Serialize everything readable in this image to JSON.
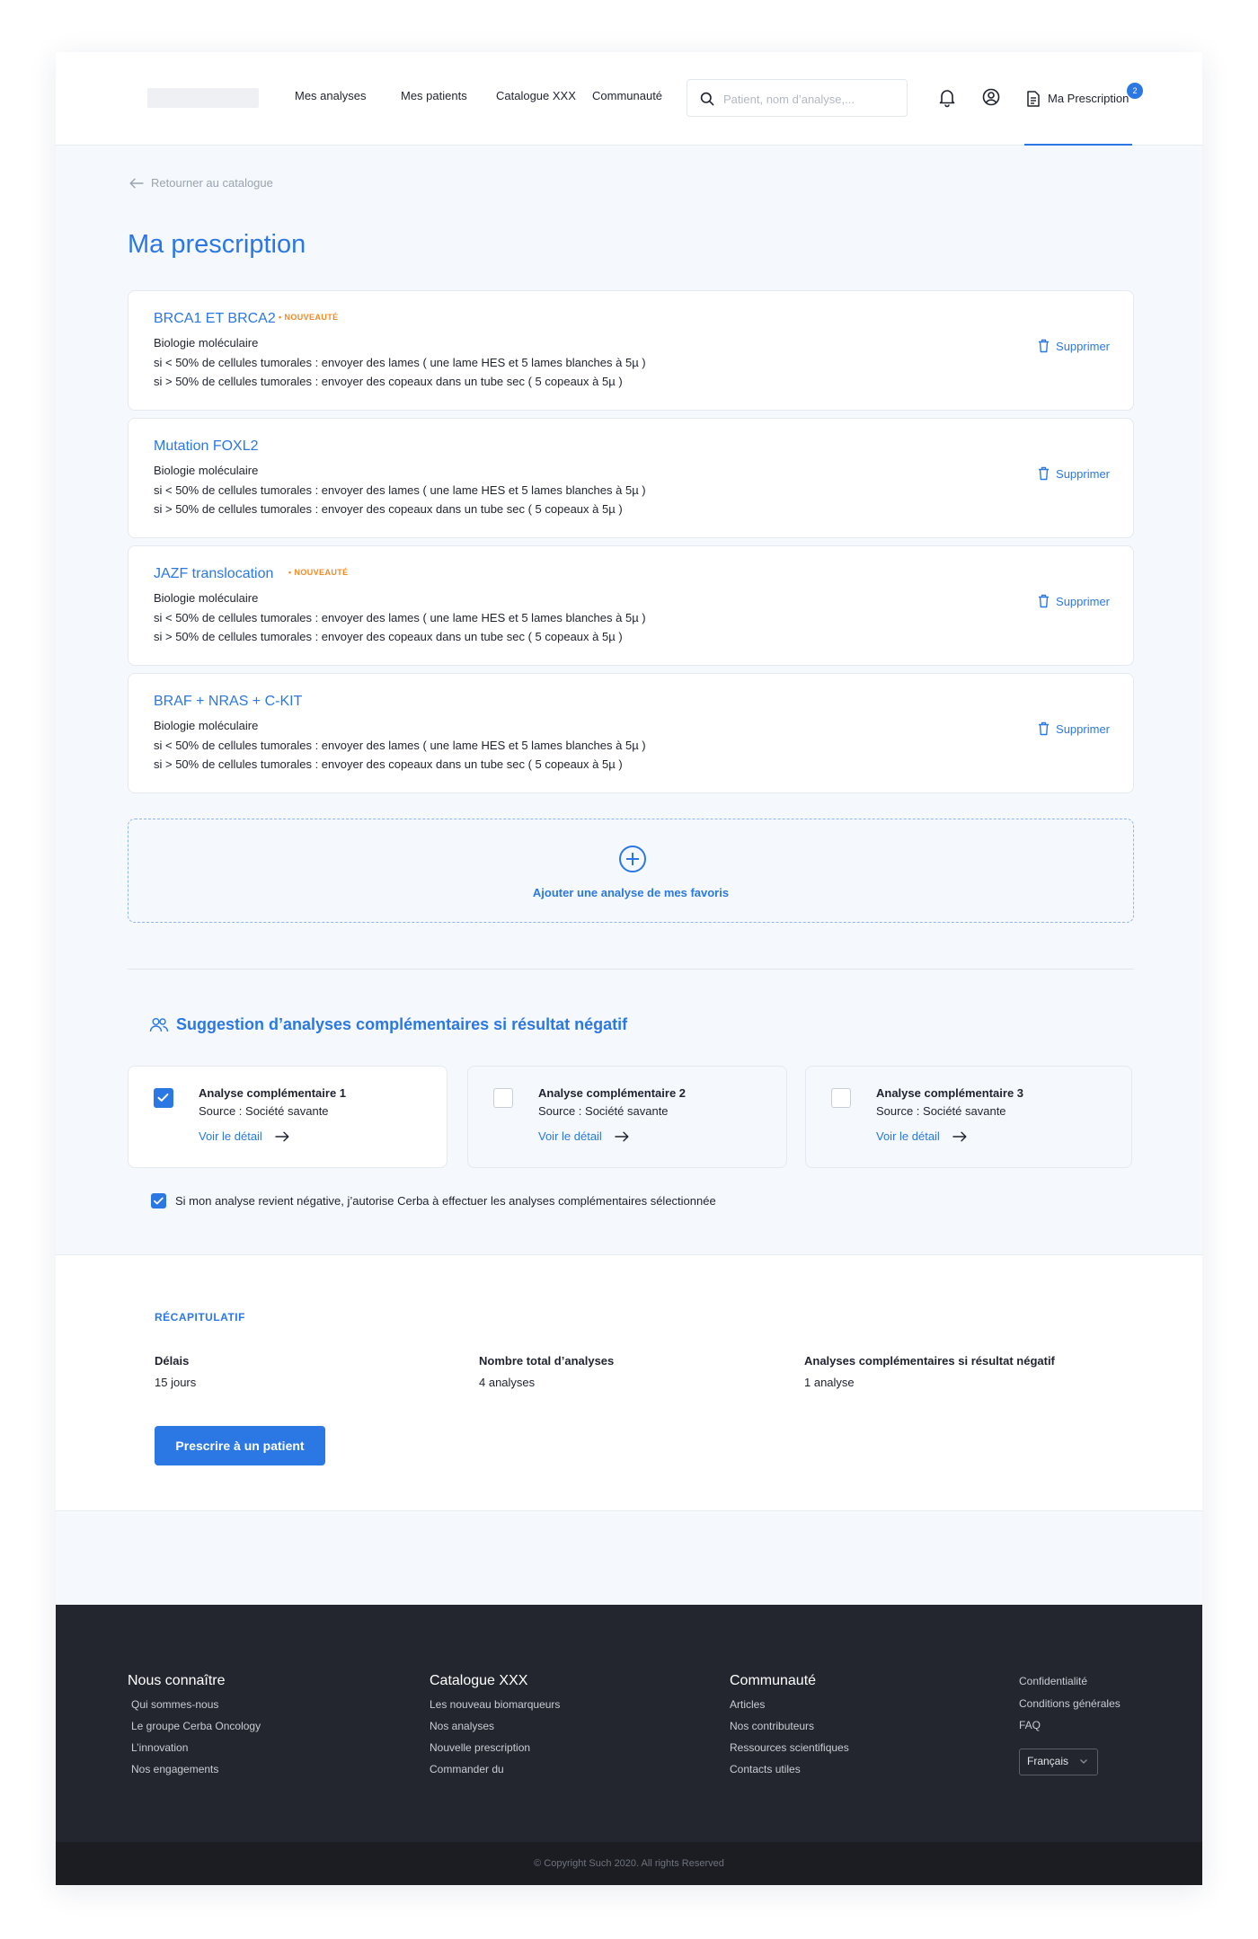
{
  "header": {
    "nav": [
      "Mes analyses",
      "Mes patients",
      "Catalogue XXX",
      "Communauté"
    ],
    "search_placeholder": "Patient, nom d’analyse,...",
    "prescription_label": "Ma Prescription",
    "prescription_count": "2",
    "icons": [
      "bell-icon",
      "user-circle-icon",
      "document-icon",
      "search-icon"
    ]
  },
  "back_label": "Retourner au catalogue",
  "page_title": "Ma prescription",
  "analyses": [
    {
      "name": "BRCA1 ET BRCA2",
      "tag": "• NOUVEAUTÉ",
      "category": "Biologie moléculaire",
      "line1": "si < 50% de cellules tumorales : envoyer des lames ( une lame HES et 5 lames blanches à 5µ )",
      "line2": "si > 50% de cellules tumorales : envoyer des copeaux dans un tube sec ( 5 copeaux à 5µ )",
      "delete": "Supprimer"
    },
    {
      "name": "Mutation FOXL2",
      "tag": "",
      "category": "Biologie moléculaire",
      "line1": "si < 50% de cellules tumorales : envoyer des lames ( une lame HES et 5 lames blanches à 5µ )",
      "line2": "si > 50% de cellules tumorales : envoyer des copeaux dans un tube sec ( 5 copeaux à 5µ )",
      "delete": "Supprimer"
    },
    {
      "name": "JAZF translocation",
      "tag": "• NOUVEAUTÉ",
      "category": "Biologie moléculaire",
      "line1": "si < 50% de cellules tumorales : envoyer des lames ( une lame HES et 5 lames blanches à 5µ )",
      "line2": "si > 50% de cellules tumorales : envoyer des copeaux dans un tube sec ( 5 copeaux à 5µ )",
      "delete": "Supprimer"
    },
    {
      "name": "BRAF + NRAS + C-KIT",
      "tag": "",
      "category": "Biologie moléculaire",
      "line1": "si < 50% de cellules tumorales : envoyer des lames ( une lame HES et 5 lames blanches à 5µ )",
      "line2": "si > 50% de cellules tumorales : envoyer des copeaux dans un tube sec ( 5 copeaux à 5µ )",
      "delete": "Supprimer"
    }
  ],
  "add_favorite_label": "Ajouter une analyse de mes favoris",
  "suggestions": {
    "title": "Suggestion d’analyses complémentaires si résultat négatif",
    "items": [
      {
        "title": "Analyse complémentaire 1",
        "source": "Source : Société savante",
        "detail": "Voir le détail",
        "checked": true
      },
      {
        "title": "Analyse complémentaire 2",
        "source": "Source : Société savante",
        "detail": "Voir le détail",
        "checked": false
      },
      {
        "title": "Analyse complémentaire 3",
        "source": "Source : Société savante",
        "detail": "Voir le détail",
        "checked": false
      }
    ],
    "consent": "Si mon analyse revient négative, j’autorise Cerba à effectuer les analyses complémentaires sélectionnée",
    "consent_checked": true
  },
  "recap": {
    "heading": "RÉCAPITULATIF",
    "delay_label": "Délais",
    "delay_value": "15 jours",
    "total_label": "Nombre total d’analyses",
    "total_value": "4 analyses",
    "compl_label": "Analyses complémentaires si résultat négatif",
    "compl_value": "1 analyse",
    "button": "Prescrire à un patient"
  },
  "footer": {
    "col1": {
      "title": "Nous connaître",
      "links": [
        "Qui sommes-nous",
        "Le groupe Cerba Oncology",
        "L’innovation",
        "Nos engagements"
      ]
    },
    "col2": {
      "title": "Catalogue XXX",
      "links": [
        "Les nouveau biomarqueurs",
        "Nos analyses",
        "Nouvelle prescription",
        "Commander du"
      ]
    },
    "col3": {
      "title": "Communauté",
      "links": [
        "Articles",
        "Nos contributeurs",
        "Ressources scientifiques",
        "Contacts utiles"
      ]
    },
    "col4": {
      "links": [
        "Confidentialité",
        "Conditions générales",
        "FAQ"
      ]
    },
    "language": "Français",
    "copyright": "© Copyright Such 2020. All rights Reserved"
  },
  "colors": {
    "accent": "#2b78e4",
    "new_tag": "#f08a24",
    "footer_bg": "#23262e",
    "page_bg": "#f5f8fd"
  }
}
